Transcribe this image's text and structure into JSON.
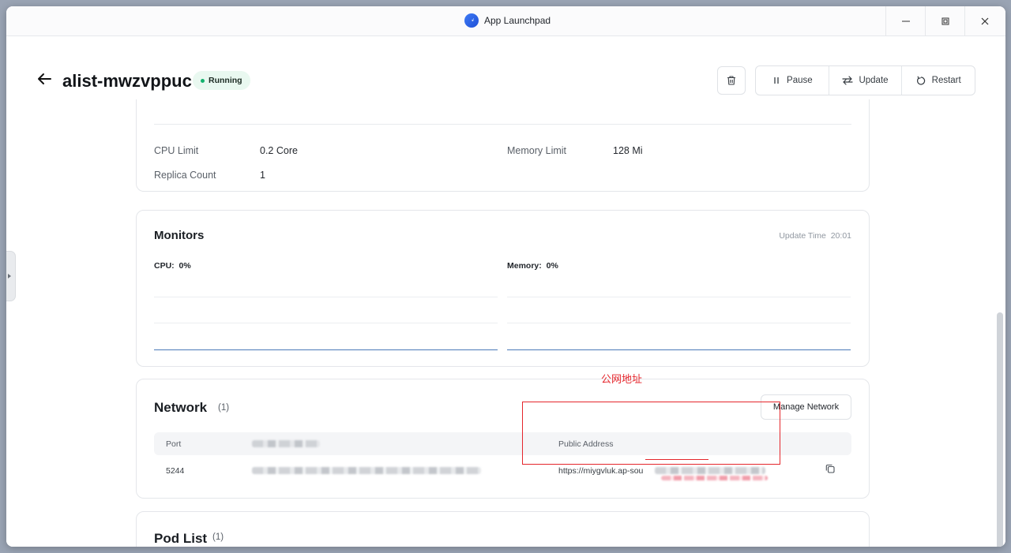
{
  "window": {
    "title": "App Launchpad"
  },
  "header": {
    "app_name": "alist-mwzvppuc",
    "status": "Running",
    "actions": {
      "pause": "Pause",
      "update": "Update",
      "restart": "Restart"
    }
  },
  "resources": {
    "cpu_limit_label": "CPU Limit",
    "cpu_limit_value": "0.2 Core",
    "memory_limit_label": "Memory Limit",
    "memory_limit_value": "128 Mi",
    "replica_label": "Replica Count",
    "replica_value": "1"
  },
  "monitors": {
    "title": "Monitors",
    "update_time_label": "Update Time",
    "update_time_value": "20:01",
    "cpu_label": "CPU:",
    "cpu_value": "0%",
    "memory_label": "Memory:",
    "memory_value": "0%"
  },
  "network": {
    "title": "Network",
    "count": "(1)",
    "manage_button": "Manage Network",
    "columns": {
      "port": "Port",
      "public_address": "Public Address"
    },
    "rows": [
      {
        "port": "5244",
        "public_address": "https://miygvluk.ap-sou"
      }
    ]
  },
  "pods": {
    "title": "Pod List",
    "count": "(1)"
  },
  "annotation": {
    "label": "公网地址"
  },
  "colors": {
    "accent": "#3e7bf5",
    "running_green": "#13b26e",
    "annotation_red": "#e5262c"
  }
}
